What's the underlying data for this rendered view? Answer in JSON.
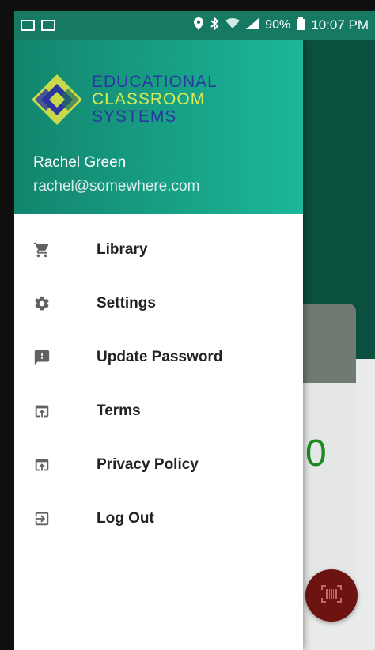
{
  "status_bar": {
    "battery": "90%",
    "time": "10:07 PM"
  },
  "drawer": {
    "logo": {
      "line1": "EDUCATIONAL",
      "line2": "CLASSROOM",
      "line3": "SYSTEMS"
    },
    "user": {
      "name": "Rachel Green",
      "email": "rachel@somewhere.com"
    },
    "menu": [
      {
        "label": "Library",
        "icon": "cart-icon"
      },
      {
        "label": "Settings",
        "icon": "gear-icon"
      },
      {
        "label": "Update Password",
        "icon": "feedback-icon"
      },
      {
        "label": "Terms",
        "icon": "open-in-browser-icon"
      },
      {
        "label": "Privacy Policy",
        "icon": "open-in-browser-icon"
      },
      {
        "label": "Log Out",
        "icon": "exit-icon"
      }
    ]
  },
  "background": {
    "value": "0"
  },
  "colors": {
    "status_bar": "#157a61",
    "drawer_header_start": "#12856d",
    "drawer_header_end": "#1cb79a",
    "app_header": "#0b4f3f",
    "fab": "#6d1412",
    "value_green": "#1b8a22"
  }
}
